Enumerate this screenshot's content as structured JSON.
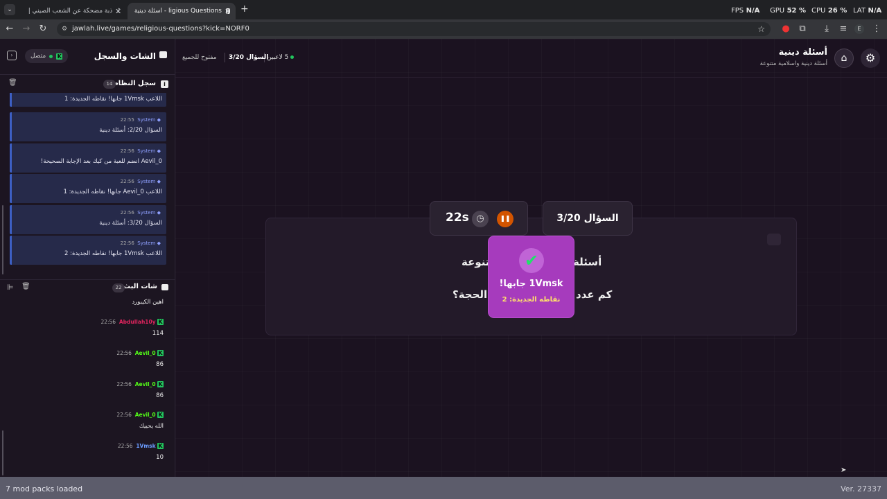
{
  "browser": {
    "tabs": [
      {
        "label": "ذبة مضحكة عن الشعب الصيني |"
      },
      {
        "label": "ligious Questions - أسئلة دينية"
      }
    ],
    "url": "jawlah.live/games/religious-questions?kick=NORF0",
    "profile_initial": "E"
  },
  "perf": {
    "fps_label": "FPS",
    "fps_value": "N/A",
    "gpu_label": "GPU",
    "gpu_value": "52",
    "cpu_label": "CPU",
    "cpu_value": "26",
    "lat_label": "LAT",
    "lat_value": "N/A",
    "percent": "%"
  },
  "sidebar": {
    "title": "الشات والسجل",
    "status": "متصل",
    "system_log": {
      "title": "سجل النظام",
      "count": "14",
      "items": [
        {
          "author": "",
          "time": "",
          "message": "اللاعب 1Vmsk جابها! نقاطه الجديدة: 1"
        },
        {
          "author": "System",
          "time": "22:55",
          "message": "السؤال 2/20: أسئلة دينية"
        },
        {
          "author": "System",
          "time": "22:56",
          "message": "Aevil_0 انضم للعبة من كيك بعد الإجابة الصحيحة!"
        },
        {
          "author": "System",
          "time": "22:56",
          "message": "اللاعب Aevil_0 جابها! نقاطه الجديدة: 1"
        },
        {
          "author": "System",
          "time": "22:56",
          "message": "السؤال 3/20: أسئلة دينية"
        },
        {
          "author": "System",
          "time": "22:56",
          "message": "اللاعب 1Vmsk جابها! نقاطه الجديدة: 2"
        }
      ]
    },
    "live_chat": {
      "title": "شات البث",
      "count": "22",
      "messages": [
        {
          "user": "",
          "time": "",
          "text": "اهين الكيبورد",
          "color": "#ffffff"
        },
        {
          "user": "Abdullah10y",
          "time": "22:56",
          "text": "114",
          "color": "#e0245e"
        },
        {
          "user": "Aevil_0",
          "time": "22:56",
          "text": "86",
          "color": "#53fc18"
        },
        {
          "user": "Aevil_0",
          "time": "22:56",
          "text": "86",
          "color": "#53fc18"
        },
        {
          "user": "Aevil_0",
          "time": "22:56",
          "text": "الله يحييك",
          "color": "#53fc18"
        },
        {
          "user": "1Vmsk",
          "time": "22:56",
          "text": "10",
          "color": "#6b9cff"
        }
      ]
    }
  },
  "game": {
    "title": "أسئلة دينية",
    "subtitle": "أسئلة دينية واسلامية متنوعة",
    "players": "5 لاعبين",
    "question_progress": "السؤال 3/20",
    "mode": "مفتوح للجميع",
    "question_badge": "السؤال 3/20",
    "timer": "22s",
    "category_partial_right": "أسئلة",
    "category_partial_left": "تنوعة",
    "question_partial_right": "كم عدد",
    "question_partial_left": "الحجة؟"
  },
  "popup": {
    "title": "1Vmsk جابها!",
    "subtitle": "نقاطه الجديدة: 2"
  },
  "statusbar": {
    "left": "7 mod packs loaded",
    "right": "Ver. 27337"
  },
  "colors": {
    "accent_purple": "#a63bbd",
    "kick_green": "#53fc18",
    "pause_orange": "#d35400"
  }
}
